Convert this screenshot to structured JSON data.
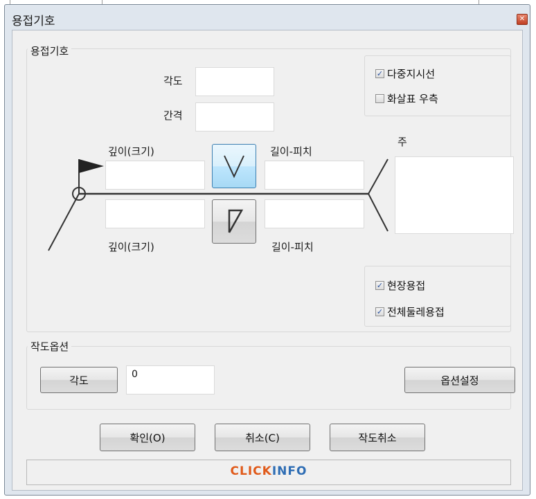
{
  "window": {
    "title": "용접기호",
    "close_icon": "close-icon"
  },
  "weld_symbol_group": {
    "label": "용접기호",
    "angle_label": "각도",
    "angle_value": "",
    "spacing_label": "간격",
    "spacing_value": "",
    "depth_upper_label": "깊이(크기)",
    "depth_upper_value": "",
    "depth_lower_label": "깊이(크기)",
    "depth_lower_value": "",
    "length_pitch_upper_label": "길이-피치",
    "length_pitch_upper_value": "",
    "length_pitch_lower_label": "길이-피치",
    "length_pitch_lower_value": "",
    "note_label": "주",
    "note_value": "",
    "upper_symbol_icon": "v-groove-weld-icon",
    "lower_symbol_icon": "bevel-groove-weld-icon",
    "multi_leader": {
      "label": "다중지시선",
      "checked": true
    },
    "arrow_right": {
      "label": "화살표 우측",
      "checked": false
    },
    "field_weld": {
      "label": "현장용접",
      "checked": true
    },
    "all_around": {
      "label": "전체둘레용접",
      "checked": true
    }
  },
  "draw_options_group": {
    "label": "작도옵션",
    "angle_button": "각도",
    "angle_value": "0",
    "options_button": "옵션설정"
  },
  "footer": {
    "ok_button": "확인(O)",
    "cancel_button": "취소(C)",
    "cancel_draw_button": "작도취소"
  },
  "status": {
    "logo_part1": "CLICK",
    "logo_part2": "INFO"
  },
  "colors": {
    "accent_blue": "#3c7fb1",
    "logo_orange": "#e05a1a",
    "logo_blue": "#2e6db4"
  }
}
